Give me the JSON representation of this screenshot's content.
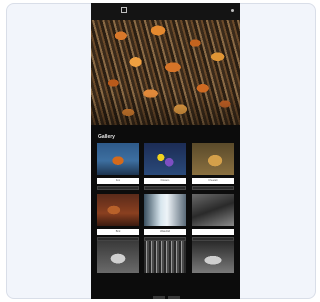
{
  "section": {
    "title": "Gallery"
  },
  "hero": {
    "alt": "monarch butterflies"
  },
  "gallery": {
    "tiles": [
      {
        "caption": "Fox",
        "image": "fox"
      },
      {
        "caption": "Flowers",
        "image": "flower"
      },
      {
        "caption": "Cheetah",
        "image": "cheetah"
      },
      {
        "caption": "Bird",
        "image": "bird"
      },
      {
        "caption": "Waterfall",
        "image": "waterfall"
      },
      {
        "caption": "",
        "image": "bw1"
      },
      {
        "caption": "",
        "image": "bw2"
      },
      {
        "caption": "",
        "image": "bw3"
      },
      {
        "caption": "",
        "image": "bw4"
      }
    ]
  },
  "icons": {
    "logo": "logo-square-icon",
    "menu": "menu-icon"
  }
}
